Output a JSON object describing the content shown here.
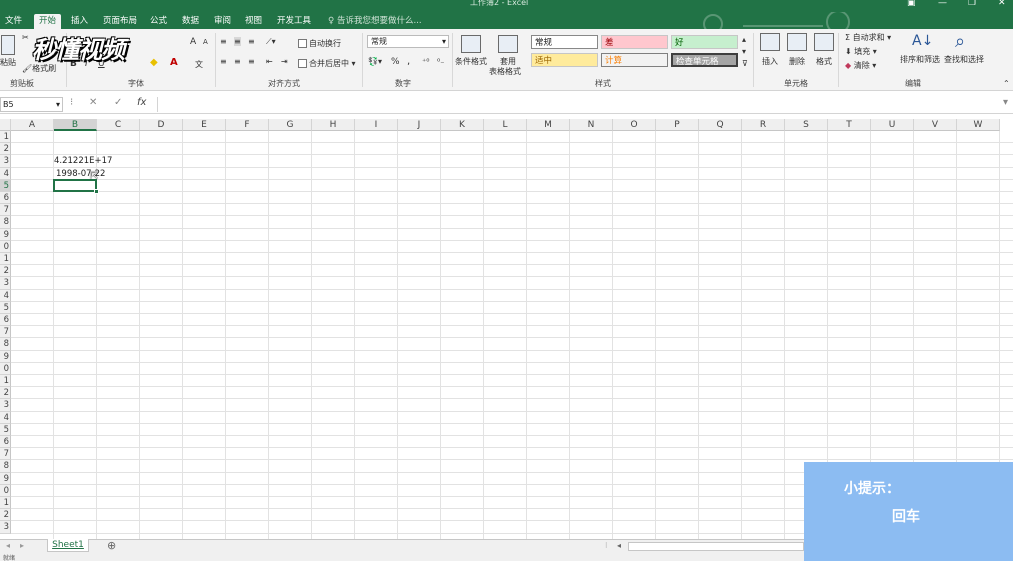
{
  "window": {
    "title": "工作簿2 - Excel"
  },
  "tabs": [
    "文件",
    "开始",
    "插入",
    "页面布局",
    "公式",
    "数据",
    "审阅",
    "视图",
    "开发工具"
  ],
  "active_tab": "开始",
  "search_hint": "告诉我您想要做什么...",
  "ribbon": {
    "clipboard": {
      "paste": "粘贴",
      "format_painter": "格式刷",
      "group": "剪贴板"
    },
    "font": {
      "bold": "B",
      "italic": "I",
      "underline": "U",
      "grow": "A",
      "shrink": "A",
      "group": "字体"
    },
    "alignment": {
      "wrap": "自动换行",
      "merge": "合并后居中",
      "group": "对齐方式"
    },
    "number": {
      "format": "常规",
      "percent": "%",
      "comma": ",",
      "group": "数字"
    },
    "styles": {
      "conditional": "条件格式",
      "table_line1": "套用",
      "table_line2": "表格格式",
      "items": [
        "常规",
        "差",
        "好",
        "适中",
        "计算",
        "检查单元格"
      ],
      "group": "样式"
    },
    "cells": {
      "insert": "插入",
      "delete": "删除",
      "format": "格式",
      "group": "单元格"
    },
    "editing": {
      "autosum": "自动求和",
      "fill": "填充",
      "clear": "清除",
      "sort": "排序和筛选",
      "find": "查找和选择",
      "group": "编辑"
    }
  },
  "watermark": "秒懂视频",
  "formula_bar": {
    "name_box": "B5",
    "cancel": "✕",
    "enter": "✓",
    "fx": "fx",
    "value": ""
  },
  "columns": [
    "A",
    "B",
    "C",
    "D",
    "E",
    "F",
    "G",
    "H",
    "I",
    "J",
    "K",
    "L",
    "M",
    "N",
    "O",
    "P",
    "Q",
    "R",
    "S",
    "T",
    "U",
    "V",
    "W"
  ],
  "rows": [
    "1",
    "2",
    "3",
    "4",
    "5",
    "6",
    "7",
    "8",
    "9",
    "0",
    "1",
    "2",
    "3",
    "4",
    "5",
    "6",
    "7",
    "8",
    "9",
    "0",
    "1",
    "2",
    "3",
    "4",
    "5",
    "6",
    "7",
    "8",
    "9",
    "0",
    "1",
    "2",
    "3"
  ],
  "cells": {
    "B3": "4.21221E+17",
    "B4": "1998-07-22"
  },
  "selected_cell": "B5",
  "sheets": [
    "Sheet1"
  ],
  "status": "就绪",
  "tip": {
    "title": "小提示：",
    "text": "回车"
  },
  "colors": {
    "excel_green": "#217346",
    "tip_bg": "#8cbcf2",
    "bad": "#ffc7ce",
    "good": "#c6efce",
    "neutral": "#ffeb9c",
    "check": "#a5a5a5"
  }
}
